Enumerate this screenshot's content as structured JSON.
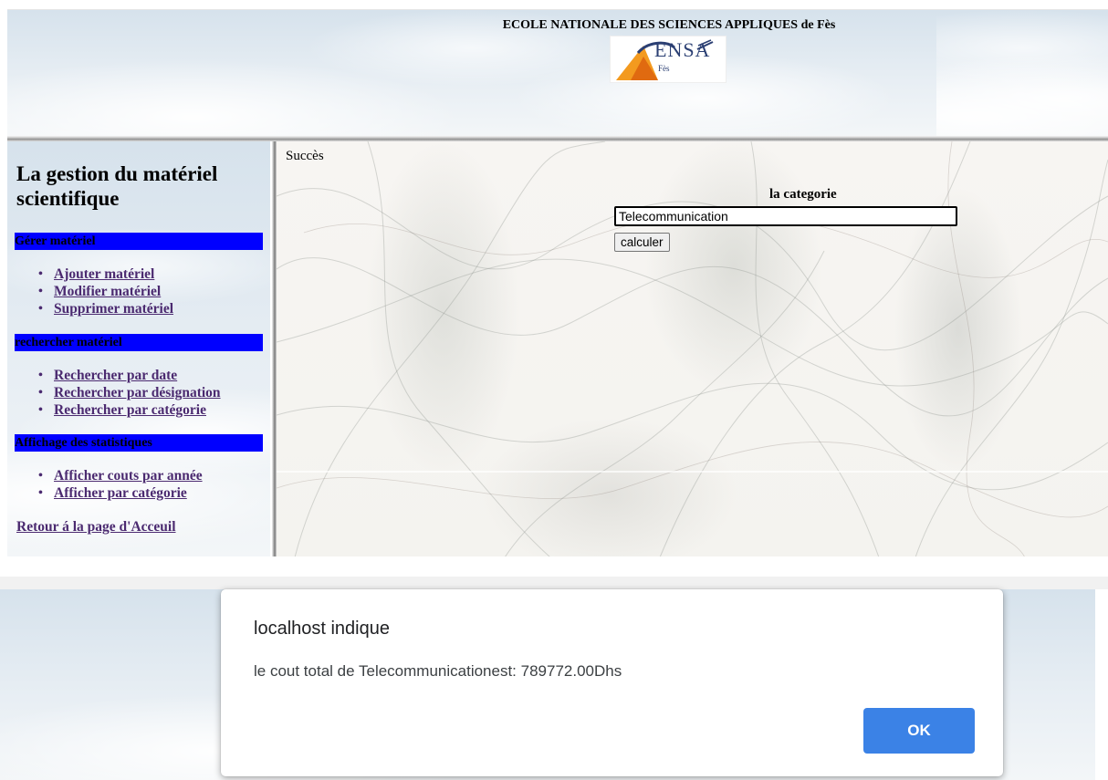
{
  "header": {
    "school_title": "ECOLE NATIONALE DES SCIENCES APPLIQUES de Fès",
    "logo_text": "ENSA",
    "logo_subtext": "Fès"
  },
  "nav": {
    "title": "La gestion du matériel scientifique",
    "sections": [
      {
        "heading": "Gérer matériel",
        "links": [
          "Ajouter matériel",
          "Modifier matériel",
          "Supprimer matériel"
        ]
      },
      {
        "heading": "rechercher matériel",
        "links": [
          "Rechercher par date",
          "Rechercher par désignation",
          "Rechercher par catégorie"
        ]
      },
      {
        "heading": "Affichage des statistiques",
        "links": [
          "Afficher couts par année",
          "Afficher par catégorie"
        ]
      }
    ],
    "home_link": "Retour á la page d'Acceuil"
  },
  "main": {
    "status": "Succès",
    "category_label": "la categorie",
    "category_value": "Telecommunication",
    "calc_button": "calculer"
  },
  "alert": {
    "title": "localhost indique",
    "message": "le cout total de Telecommunicationest: 789772.00Dhs",
    "ok_label": "OK"
  },
  "colors": {
    "section_bar": "#0000ff",
    "link": "#4b2a70",
    "ok_button": "#3b82e6"
  }
}
